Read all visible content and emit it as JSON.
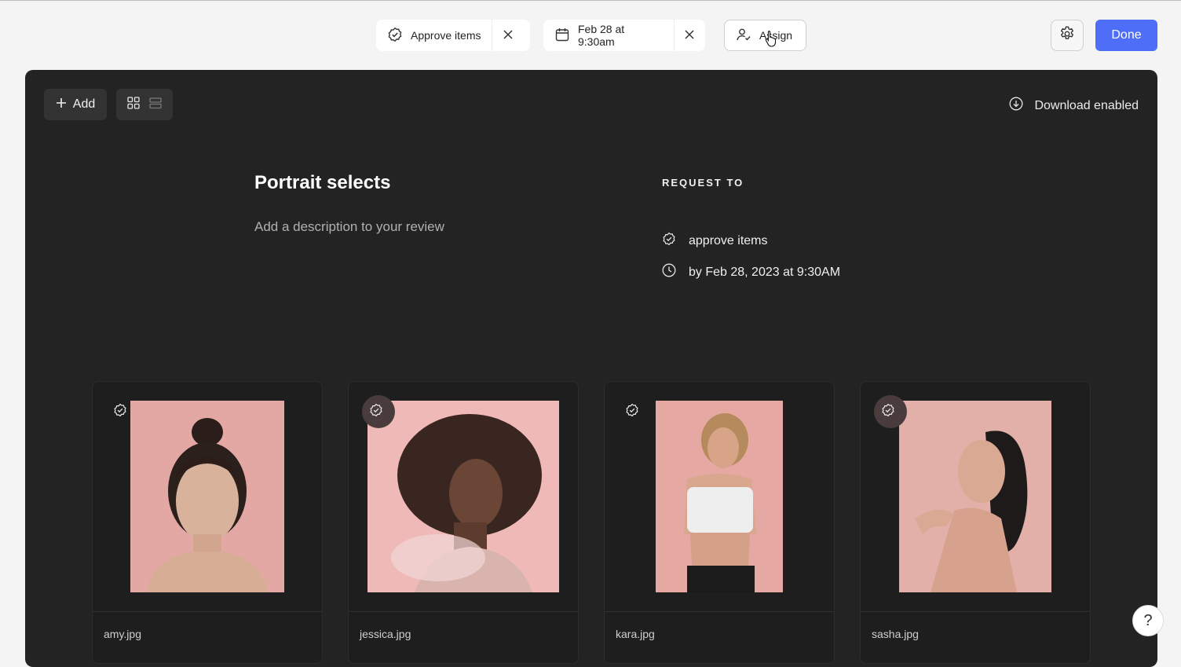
{
  "toolbar": {
    "approve_label": "Approve items",
    "date_label": "Feb 28 at 9:30am",
    "assign_label": "Assign",
    "done_label": "Done"
  },
  "panel": {
    "add_label": "Add",
    "download_label": "Download enabled",
    "title": "Portrait selects",
    "description_placeholder": "Add a description to your review",
    "request_to_label": "REQUEST TO",
    "request_action": "approve items",
    "request_deadline": "by Feb 28, 2023 at 9:30AM"
  },
  "cards": [
    {
      "filename": "amy.jpg"
    },
    {
      "filename": "jessica.jpg"
    },
    {
      "filename": "kara.jpg"
    },
    {
      "filename": "sasha.jpg"
    }
  ],
  "help": {
    "label": "?"
  },
  "colors": {
    "accent": "#4f6ef7",
    "panel_bg": "#232323",
    "page_bg": "#f4f4f5",
    "photo_pink": "#e8a8a6"
  }
}
